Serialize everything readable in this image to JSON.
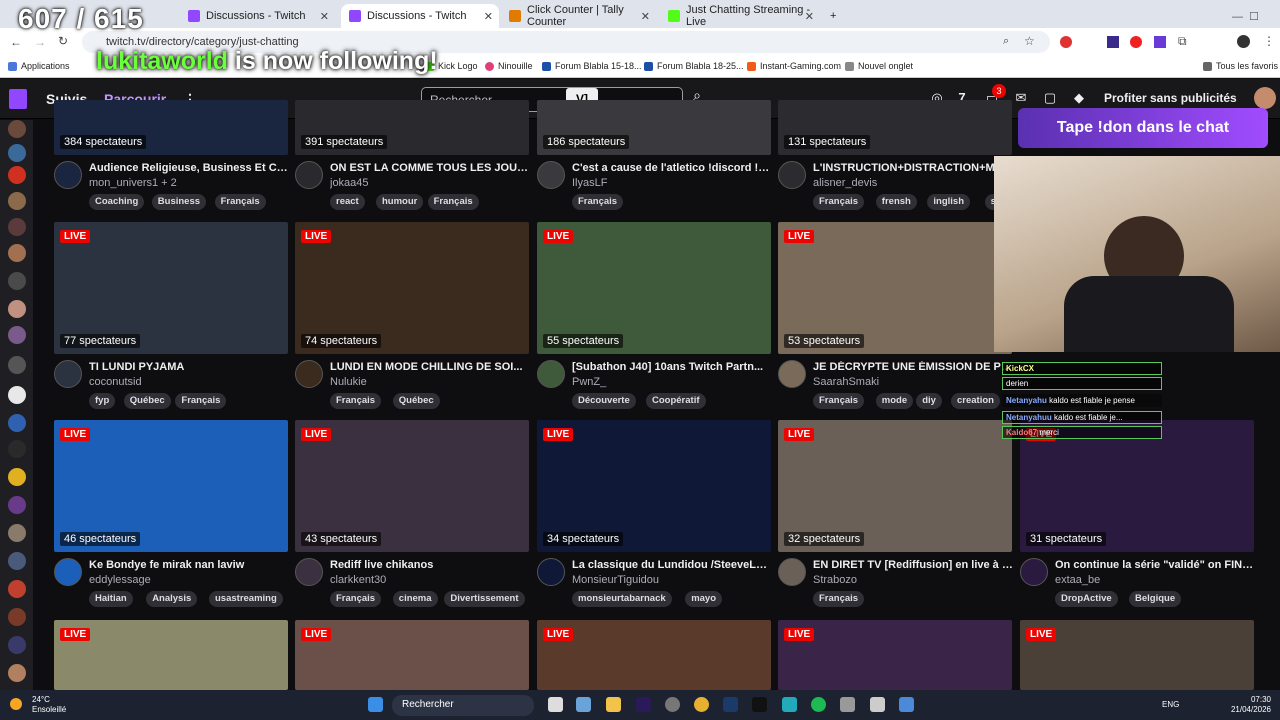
{
  "browser": {
    "tabs": [
      {
        "label": "Discussions - Twitch"
      },
      {
        "label": "Discussions - Twitch"
      },
      {
        "label": "Click Counter | Tally Counter"
      },
      {
        "label": "Just Chatting Streaming - Live"
      }
    ],
    "new_tab": "+",
    "url": "twitch.tv/directory/category/just-chatting",
    "bookmarks": [
      "Applications",
      "Kick Logo",
      "Ninouille",
      "Forum Blabla 15-18...",
      "Forum Blabla 18-25...",
      "Instant-Gaming.com",
      "Nouvel onglet",
      "Tous les favoris"
    ]
  },
  "overlay": {
    "counter": "607 / 615",
    "follow_user": "lukitaworld",
    "follow_text": " is now following!",
    "don_banner": "Tape !don dans le chat",
    "chat": [
      {
        "user": "KickCX",
        "text": ""
      },
      {
        "user": "",
        "text": "derien"
      },
      {
        "user": "Netanyahu",
        "text": "kaldo est fiable je pense"
      },
      {
        "user": "Netanyahuu",
        "text": "kaldo est fiable je..."
      },
      {
        "user": "Kaldo67",
        "text": "merci"
      }
    ]
  },
  "twitch": {
    "nav": {
      "following": "Suivis",
      "browse": "Parcourir",
      "search_placeholder": "Rechercher",
      "notif_count": "3",
      "ad_free": "Profiter sans publicités"
    },
    "live_label": "LIVE",
    "cards": [
      {
        "viewers": "384 spectateurs",
        "title": "Audience Religieuse, Business Et Coa...",
        "channel": "mon_univers1 + 2",
        "tags": [
          "Coaching",
          "Business",
          "Français"
        ],
        "color": "#1a2540"
      },
      {
        "viewers": "391 spectateurs",
        "title": "ON EST LA COMME TOUS LES JOURS ...",
        "channel": "jokaa45",
        "tags": [
          "react",
          "humour",
          "Français"
        ],
        "color": "#2a2a2e"
      },
      {
        "viewers": "186 spectateurs",
        "title": "C'est a cause de l'atletico !discord !su...",
        "channel": "IlyasLF",
        "tags": [
          "Français"
        ],
        "color": "#3a3a3e"
      },
      {
        "viewers": "131 spectateurs",
        "title": "L'INSTRUCTION+DISTRACTION+MO...",
        "channel": "alisner_devis",
        "tags": [
          "Français",
          "frensh",
          "inglish",
          "spanish"
        ],
        "color": "#2c2c30"
      },
      {
        "viewers": "77 spectateurs",
        "title": "TI LUNDI PYJAMA",
        "channel": "coconutsid",
        "tags": [
          "fyp",
          "Québec",
          "Français"
        ],
        "color": "#2b3240"
      },
      {
        "viewers": "74 spectateurs",
        "title": "LUNDI EN MODE CHILLING DE SOI...",
        "channel": "Nulukie",
        "tags": [
          "Français",
          "Québec"
        ],
        "color": "#3b2a1e"
      },
      {
        "viewers": "55 spectateurs",
        "title": "[Subathon J40] 10ans Twitch Partn...",
        "channel": "PwnZ_",
        "tags": [
          "Découverte",
          "Coopératif"
        ],
        "color": "#3f5a3a"
      },
      {
        "viewers": "53 spectateurs",
        "title": "JE DÉCRYPTE UNE ÉMISSION DE PÂTI...",
        "channel": "SaarahSmaki",
        "tags": [
          "Français",
          "mode",
          "diy",
          "creation"
        ],
        "color": "#7a6a5a"
      },
      {
        "viewers": "46 spectateurs",
        "title": "Ke Bondye fe mirak nan laviw",
        "channel": "eddylessage",
        "tags": [
          "Haitian",
          "Analysis",
          "usastreaming"
        ],
        "color": "#1b5fb8"
      },
      {
        "viewers": "43 spectateurs",
        "title": "Rediff live chikanos",
        "channel": "clarkkent30",
        "tags": [
          "Français",
          "cinema",
          "Divertissement"
        ],
        "color": "#3a3040"
      },
      {
        "viewers": "34 spectateurs",
        "title": "La classique du Lundidou /SteeveLeM...",
        "channel": "MonsieurTiguidou",
        "tags": [
          "monsieurtabarnack",
          "mayo"
        ],
        "color": "#101838"
      },
      {
        "viewers": "32 spectateurs",
        "title": "EN DIRET TV [Rediffusion] en live à 21...",
        "channel": "Strabozo",
        "tags": [
          "Français"
        ],
        "color": "#6a6058"
      },
      {
        "viewers": "31 spectateurs",
        "title": "On continue la série \"validé\" on FINI S...",
        "channel": "extaa_be",
        "tags": [
          "DropActive",
          "Belgique"
        ],
        "color": "#2a1a40"
      },
      {
        "viewers": "",
        "title": "",
        "channel": "",
        "tags": [],
        "color": "#8a8a6a"
      },
      {
        "viewers": "",
        "title": "",
        "channel": "",
        "tags": [],
        "color": "#6a5048"
      },
      {
        "viewers": "",
        "title": "",
        "channel": "",
        "tags": [],
        "color": "#5a3a2a"
      },
      {
        "viewers": "",
        "title": "",
        "channel": "",
        "tags": [],
        "color": "#3a2448"
      },
      {
        "viewers": "",
        "title": "",
        "channel": "",
        "tags": [],
        "color": "#4a4038"
      }
    ]
  },
  "taskbar": {
    "weather_temp": "24°C",
    "weather_text": "Ensoleillé",
    "search": "Rechercher",
    "lang": "ENG",
    "time": "07:30",
    "date": "21/04/2026"
  }
}
